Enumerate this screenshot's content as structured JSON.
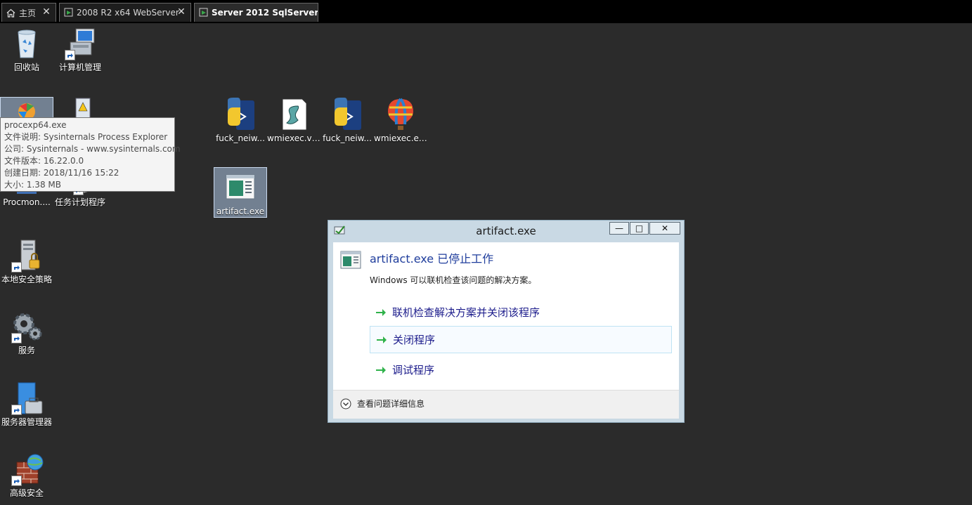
{
  "tabs": [
    {
      "label": "主页",
      "icon": "home-icon",
      "active": false
    },
    {
      "label": "2008 R2 x64 WebServer",
      "icon": "vm-icon",
      "active": false
    },
    {
      "label": "Server 2012 SqlServer",
      "icon": "vm-icon",
      "active": true
    }
  ],
  "desktop": {
    "icons": [
      {
        "label": "回收站",
        "icon": "recycle-bin-icon"
      },
      {
        "label": "计算机管理",
        "icon": "computer-management-icon"
      },
      {
        "label": "Procmon....",
        "icon": "procmon-icon"
      },
      {
        "label": "任务计划程序",
        "icon": "task-scheduler-icon"
      },
      {
        "label": "本地安全策略",
        "icon": "local-security-policy-icon"
      },
      {
        "label": "服务",
        "icon": "services-gear-icon"
      },
      {
        "label": "服务器管理器",
        "icon": "server-manager-icon"
      },
      {
        "label": "高级安全 Windows...",
        "icon": "firewall-icon"
      },
      {
        "label": "fuck_neiw...",
        "icon": "python-icon"
      },
      {
        "label": "wmiexec.vbs",
        "icon": "vbs-script-icon"
      },
      {
        "label": "fuck_neiw...",
        "icon": "python-icon"
      },
      {
        "label": "wmiexec.exe",
        "icon": "balloon-icon"
      },
      {
        "label": "artifact.exe",
        "icon": "exe-window-icon"
      }
    ]
  },
  "tooltip": {
    "lines": [
      "procexp64.exe",
      "文件说明: Sysinternals Process Explorer",
      "公司: Sysinternals - www.sysinternals.com",
      "文件版本: 16.22.0.0",
      "创建日期: 2018/11/16 15:22",
      "大小: 1.38 MB"
    ]
  },
  "dialog": {
    "title": "artifact.exe",
    "heading": "artifact.exe 已停止工作",
    "description": "Windows 可以联机检查该问题的解决方案。",
    "options": [
      "联机检查解决方案并关闭该程序",
      "关闭程序",
      "调试程序"
    ],
    "details_label": "查看问题详细信息",
    "buttons": {
      "minimize": "—",
      "maximize": "□",
      "close": "✕"
    }
  },
  "colors": {
    "desktop_bg": "#2b2b2b",
    "tabbar_bg": "#000000",
    "heading_blue": "#1f3d9c",
    "arrow_green": "#2fb24a",
    "selection": "#adc6e6"
  }
}
